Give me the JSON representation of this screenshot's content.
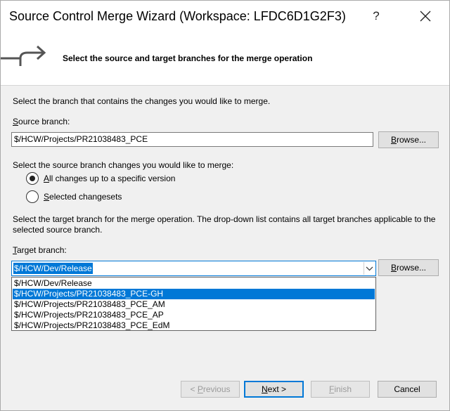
{
  "window": {
    "title": "Source Control Merge Wizard (Workspace: LFDC6D1G2F3)",
    "help_label": "?"
  },
  "header": {
    "heading": "Select the source and target branches for the merge operation"
  },
  "source": {
    "intro": "Select the branch that contains the changes you would like to merge.",
    "label_key": "S",
    "label_rest": "ource branch:",
    "value": "$/HCW/Projects/PR21038483_PCE",
    "browse_key": "B",
    "browse_rest": "rowse..."
  },
  "changes": {
    "intro": "Select the source branch changes you would like to merge:",
    "options": [
      {
        "key": "A",
        "rest": "ll changes up to a specific version",
        "selected": true
      },
      {
        "key": "S",
        "rest": "elected changesets",
        "selected": false
      }
    ]
  },
  "target": {
    "intro_line1": "Select the target branch for the merge operation.  The drop-down list contains all target branches applicable to the",
    "intro_line2": "selected source branch.",
    "label_key": "T",
    "label_rest": "arget branch:",
    "value": "$/HCW/Dev/Release",
    "browse_key": "B",
    "browse_rest": "rowse...",
    "options": [
      "$/HCW/Dev/Release",
      "$/HCW/Projects/PR21038483_PCE-GH",
      "$/HCW/Projects/PR21038483_PCE_AM",
      "$/HCW/Projects/PR21038483_PCE_AP",
      "$/HCW/Projects/PR21038483_PCE_EdM"
    ],
    "highlighted_option_index": 1
  },
  "footer": {
    "previous_prefix": "< ",
    "previous_key": "P",
    "previous_rest": "revious",
    "next_key": "N",
    "next_rest": "ext >",
    "finish_key": "F",
    "finish_rest": "inish",
    "cancel_label": "Cancel"
  },
  "colors": {
    "accent": "#0078d7",
    "dialog_bg": "#f0f0f0",
    "header_bg": "#ffffff"
  }
}
